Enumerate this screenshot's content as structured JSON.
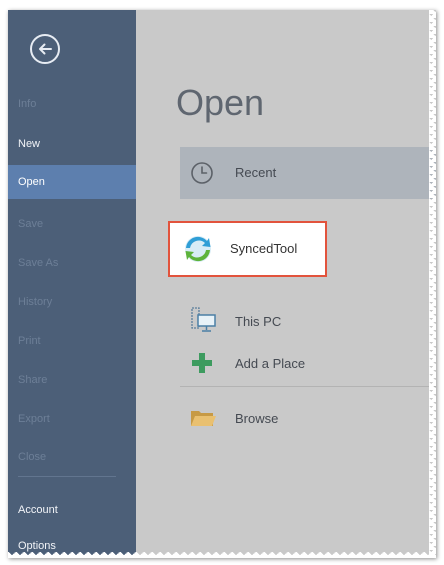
{
  "sidebar": {
    "items": [
      {
        "label": "Info"
      },
      {
        "label": "New"
      },
      {
        "label": "Open"
      },
      {
        "label": "Save"
      },
      {
        "label": "Save As"
      },
      {
        "label": "History"
      },
      {
        "label": "Print"
      },
      {
        "label": "Share"
      },
      {
        "label": "Export"
      },
      {
        "label": "Close"
      },
      {
        "label": "Account"
      },
      {
        "label": "Options"
      }
    ],
    "selected": "Open"
  },
  "main": {
    "title": "Open",
    "places": [
      {
        "label": "Recent",
        "icon": "clock-icon"
      },
      {
        "label": "SyncedTool",
        "icon": "sync-icon"
      },
      {
        "label": "This PC",
        "icon": "computer-icon"
      },
      {
        "label": "Add a Place",
        "icon": "plus-icon"
      },
      {
        "label": "Browse",
        "icon": "folder-icon"
      }
    ]
  },
  "colors": {
    "sidebar_bg": "#4c5f78",
    "selected_bg": "#5d7fae",
    "main_bg": "#c9c9c9",
    "recent_highlight": "#aeb4bb",
    "callout_border": "#e2533c"
  }
}
